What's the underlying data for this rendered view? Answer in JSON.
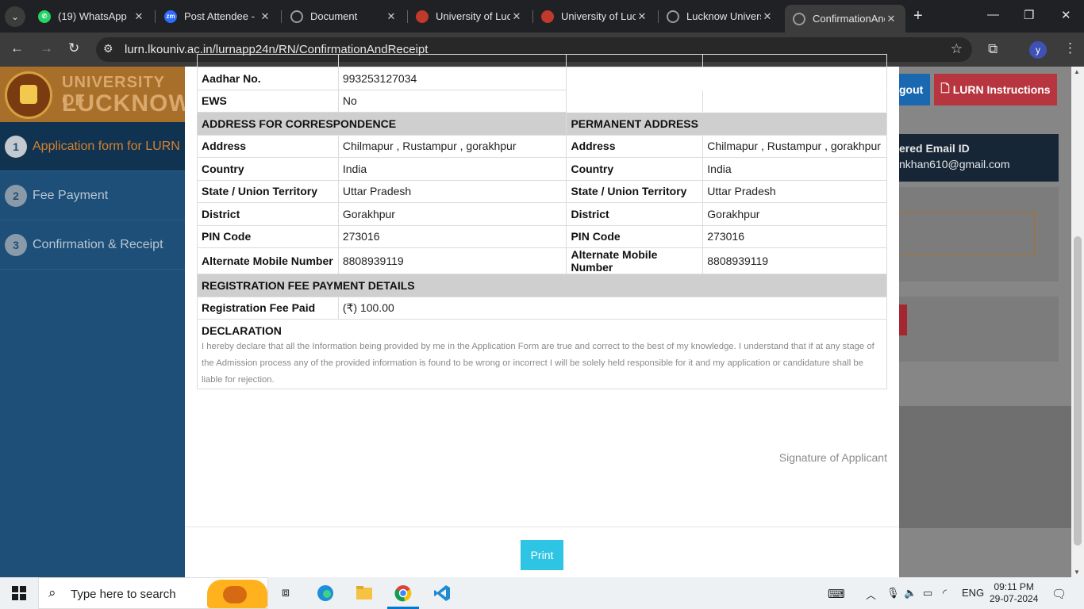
{
  "browser": {
    "tabs": [
      {
        "title": "(19) WhatsApp",
        "icon": "whatsapp-icon",
        "color": "#25d366"
      },
      {
        "title": "Post Attendee -",
        "icon": "zoom-icon",
        "color": "#2d6cff"
      },
      {
        "title": "Document",
        "icon": "globe-icon",
        "color": "#888888"
      },
      {
        "title": "University of Luc",
        "icon": "university-icon",
        "color": "#c0392b"
      },
      {
        "title": "University of Luc",
        "icon": "university-icon",
        "color": "#c0392b"
      },
      {
        "title": "Lucknow Univers",
        "icon": "globe-icon",
        "color": "#888888"
      },
      {
        "title": "ConfirmationAnc",
        "icon": "globe-icon",
        "color": "#888888",
        "active": true
      }
    ],
    "url": "lurn.lkouniv.ac.in/lurnapp24n/RN/ConfirmationAndReceipt",
    "profile_initial": "y"
  },
  "sidebar": {
    "logo_line1": "UNIVERSITY OF",
    "logo_line2": "LUCKNOW",
    "items": [
      {
        "num": "1",
        "label": "Application form for LURN"
      },
      {
        "num": "2",
        "label": "Fee Payment"
      },
      {
        "num": "3",
        "label": "Confirmation & Receipt"
      }
    ]
  },
  "background": {
    "logout_label": "gout",
    "lurn_instructions_label": "LURN Instructions",
    "email_heading": "ered Email ID",
    "email_value": "nkhan610@gmail.com"
  },
  "form": {
    "aadhar_label": "Aadhar No.",
    "aadhar_value": "993253127034",
    "ews_label": "EWS",
    "ews_value": "No",
    "correspondence_heading": "ADDRESS FOR CORRESPONDENCE",
    "permanent_heading": "PERMANENT ADDRESS",
    "address_rows": [
      {
        "label": "Address",
        "corr": "Chilmapur , Rustampur , gorakhpur",
        "perm": "Chilmapur , Rustampur , gorakhpur"
      },
      {
        "label": "Country",
        "corr": "India",
        "perm": "India"
      },
      {
        "label": "State / Union Territory",
        "corr": "Uttar Pradesh",
        "perm": "Uttar Pradesh"
      },
      {
        "label": "District",
        "corr": "Gorakhpur",
        "perm": "Gorakhpur"
      },
      {
        "label": "PIN Code",
        "corr": "273016",
        "perm": "273016"
      },
      {
        "label": "Alternate Mobile Number",
        "corr": "8808939119",
        "perm": "8808939119"
      }
    ],
    "fee_heading": "REGISTRATION FEE PAYMENT DETAILS",
    "fee_label": "Registration Fee Paid",
    "fee_value": "(₹) 100.00",
    "declaration_heading": "DECLARATION",
    "declaration_text": "I hereby declare that all the Information being provided by me in the Application Form are true and correct to the best of my knowledge. I understand that if at any stage of the Admission process any of the provided information is found to be wrong or incorrect I will be solely held responsible for it and my application or candidature shall be liable for rejection.",
    "signature_label": "Signature of Applicant",
    "print_label": "Print"
  },
  "taskbar": {
    "search_placeholder": "Type here to search",
    "language": "ENG",
    "time": "09:11 PM",
    "date": "29-07-2024"
  }
}
